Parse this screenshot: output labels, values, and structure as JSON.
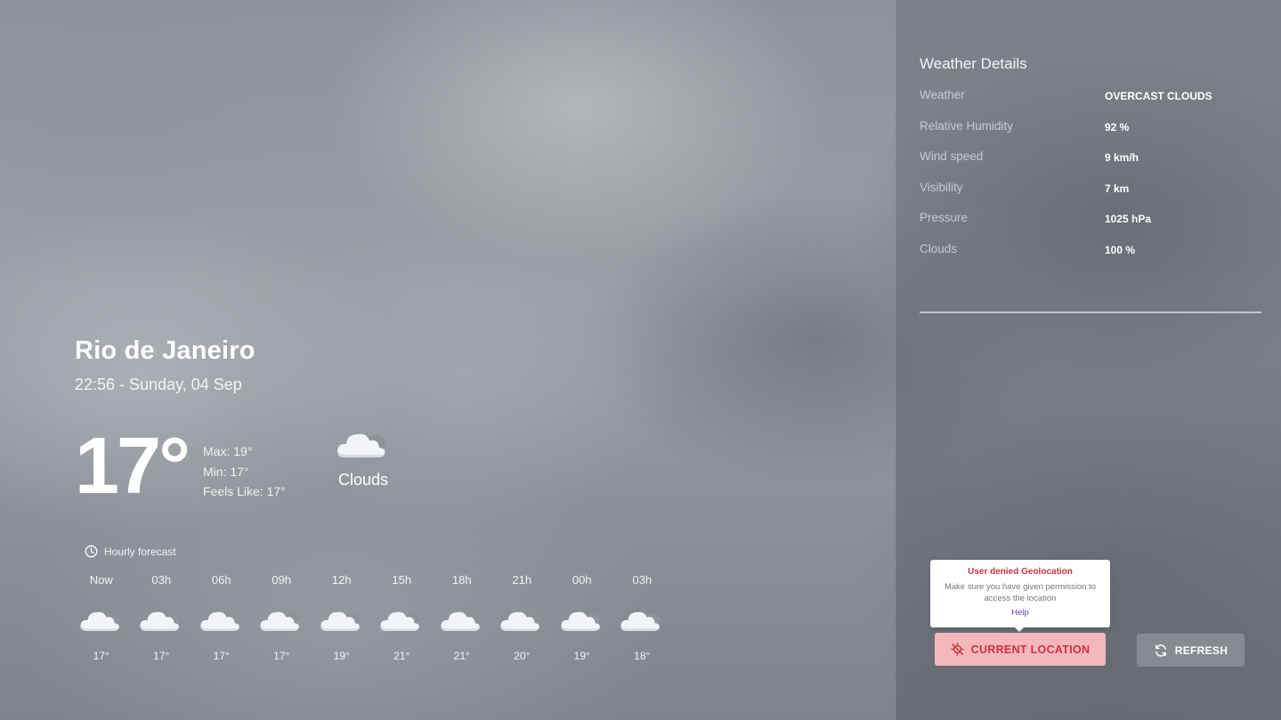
{
  "location": {
    "city": "Rio de Janeiro",
    "datetime": "22:56 - Sunday, 04 Sep"
  },
  "current": {
    "temp": "17°",
    "max": "Max: 19°",
    "min": "Min: 17°",
    "feels_like": "Feels Like: 17°",
    "condition": "Clouds",
    "icon": "cloud-icon"
  },
  "hourly": {
    "title": "Hourly forecast",
    "items": [
      {
        "time": "Now",
        "temp": "17°",
        "icon": "cloud-icon"
      },
      {
        "time": "03h",
        "temp": "17°",
        "icon": "cloud-icon"
      },
      {
        "time": "06h",
        "temp": "17°",
        "icon": "cloud-icon"
      },
      {
        "time": "09h",
        "temp": "17°",
        "icon": "cloud-icon"
      },
      {
        "time": "12h",
        "temp": "19°",
        "icon": "cloud-icon"
      },
      {
        "time": "15h",
        "temp": "21°",
        "icon": "cloud-icon"
      },
      {
        "time": "18h",
        "temp": "21°",
        "icon": "cloud-icon"
      },
      {
        "time": "21h",
        "temp": "20°",
        "icon": "cloud-icon"
      },
      {
        "time": "00h",
        "temp": "19°",
        "icon": "cloud-icon"
      },
      {
        "time": "03h",
        "temp": "18°",
        "icon": "cloud-icon"
      }
    ]
  },
  "details": {
    "title": "Weather Details",
    "rows": [
      {
        "label": "Weather",
        "value": "OVERCAST CLOUDS"
      },
      {
        "label": "Relative Humidity",
        "value": "92 %"
      },
      {
        "label": "Wind speed",
        "value": "9 km/h"
      },
      {
        "label": "Visibility",
        "value": "7 km"
      },
      {
        "label": "Pressure",
        "value": "1025 hPa"
      },
      {
        "label": "Clouds",
        "value": "100 %"
      }
    ]
  },
  "tooltip": {
    "title": "User denied Geolocation",
    "text": "Make sure you have given permission to access the location",
    "help": "Help"
  },
  "buttons": {
    "current_location": "CURRENT LOCATION",
    "refresh": "REFRESH"
  },
  "colors": {
    "accent_red": "#d0313f",
    "location_button_bg": "#f4b8bc",
    "help_link": "#6b3fa0"
  }
}
